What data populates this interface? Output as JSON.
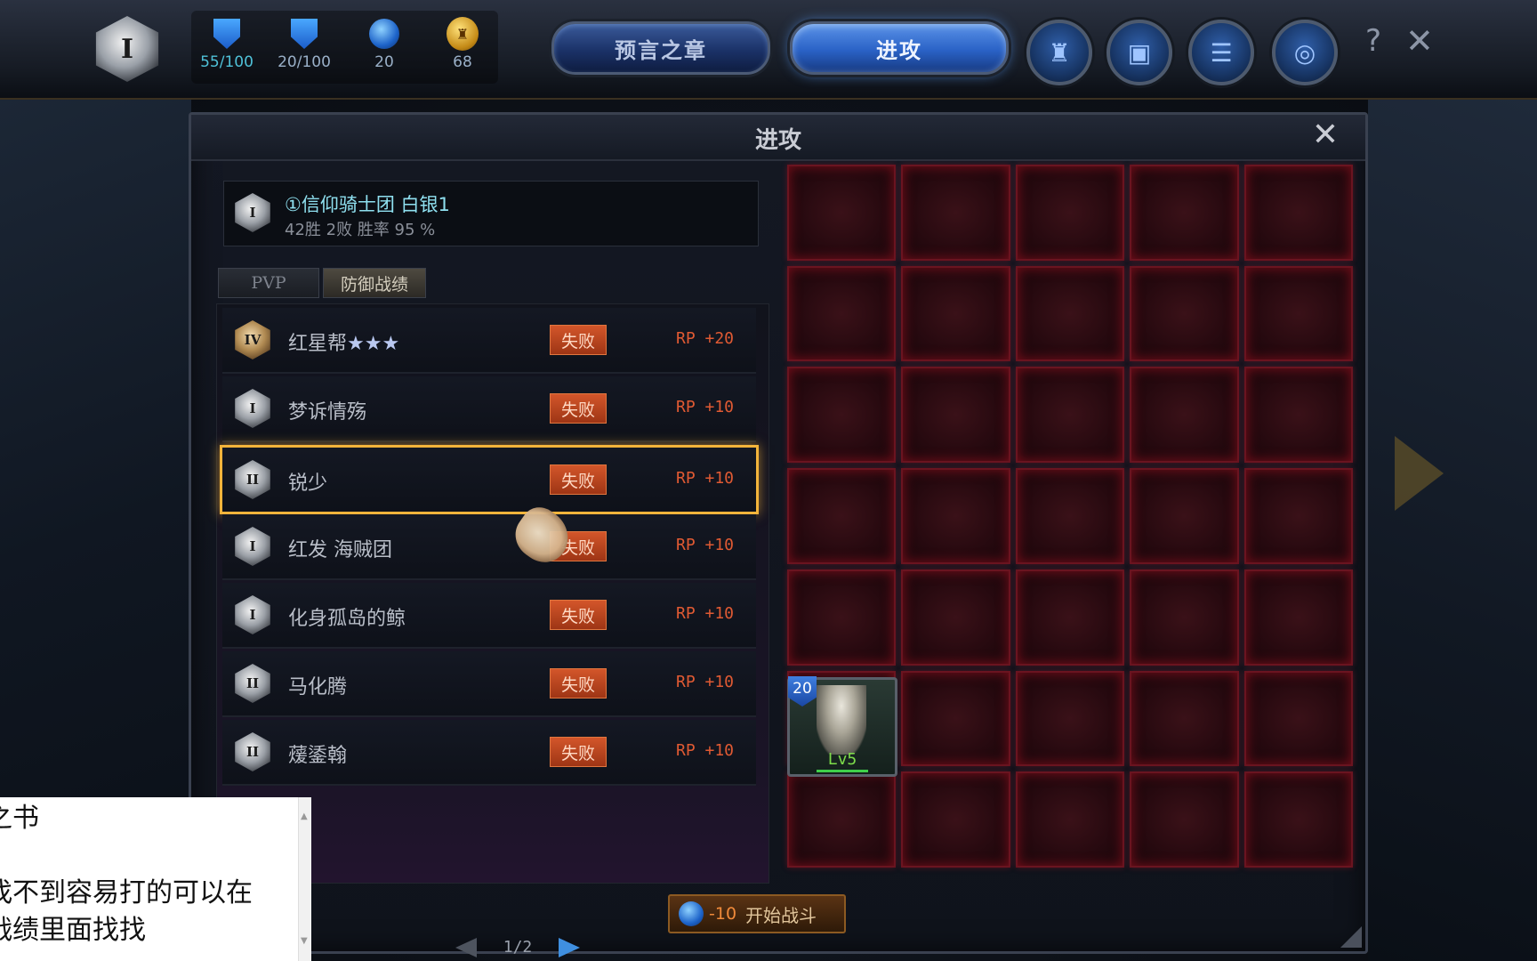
{
  "topbar": {
    "rank_emblem": "I",
    "resources": [
      {
        "icon": "sword-shield-icon",
        "value": "55/100"
      },
      {
        "icon": "shield-icon",
        "value": "20/100"
      },
      {
        "icon": "energy-orb-icon",
        "value": "20"
      },
      {
        "icon": "gold-coin-icon",
        "value": "68"
      }
    ],
    "nav": {
      "prophecy": "预言之章",
      "attack": "进攻"
    },
    "round_buttons": [
      "castle-icon",
      "cards-icon",
      "scroll-icon",
      "badge-icon"
    ],
    "help": "?",
    "close": "✕"
  },
  "panel": {
    "title": "进攻",
    "close": "✕",
    "player": {
      "emblem": "I",
      "name": "①信仰骑士团  白银1",
      "stats": "42胜 2败 胜率 95 %"
    },
    "tabs": {
      "pvp": "PVP",
      "defense": "防御战绩"
    },
    "records": [
      {
        "emblem": "IV",
        "name": "红星帮",
        "stars": "★★★",
        "result": "失败",
        "rp": "RP +20"
      },
      {
        "emblem": "I",
        "name": "梦诉情殇",
        "stars": "",
        "result": "失败",
        "rp": "RP +10"
      },
      {
        "emblem": "II",
        "name": "锐少",
        "stars": "",
        "result": "失败",
        "rp": "RP +10"
      },
      {
        "emblem": "I",
        "name": "红发 海贼团",
        "stars": "",
        "result": "失败",
        "rp": "RP +10"
      },
      {
        "emblem": "I",
        "name": "化身孤岛的鲸",
        "stars": "",
        "result": "失败",
        "rp": "RP +10"
      },
      {
        "emblem": "II",
        "name": "马化腾",
        "stars": "",
        "result": "失败",
        "rp": "RP +10"
      },
      {
        "emblem": "II",
        "name": "蕿鋈翰",
        "stars": "",
        "result": "失败",
        "rp": "RP +10"
      }
    ],
    "pager": {
      "page": "1/2"
    },
    "unit": {
      "level_badge": "20",
      "lv": "Lv5"
    },
    "start_button": {
      "cost": "-10",
      "label": "开始战斗"
    }
  },
  "caption": {
    "line1": "之书",
    "line2": "找不到容易打的可以在",
    "line3": "战绩里面找找"
  }
}
